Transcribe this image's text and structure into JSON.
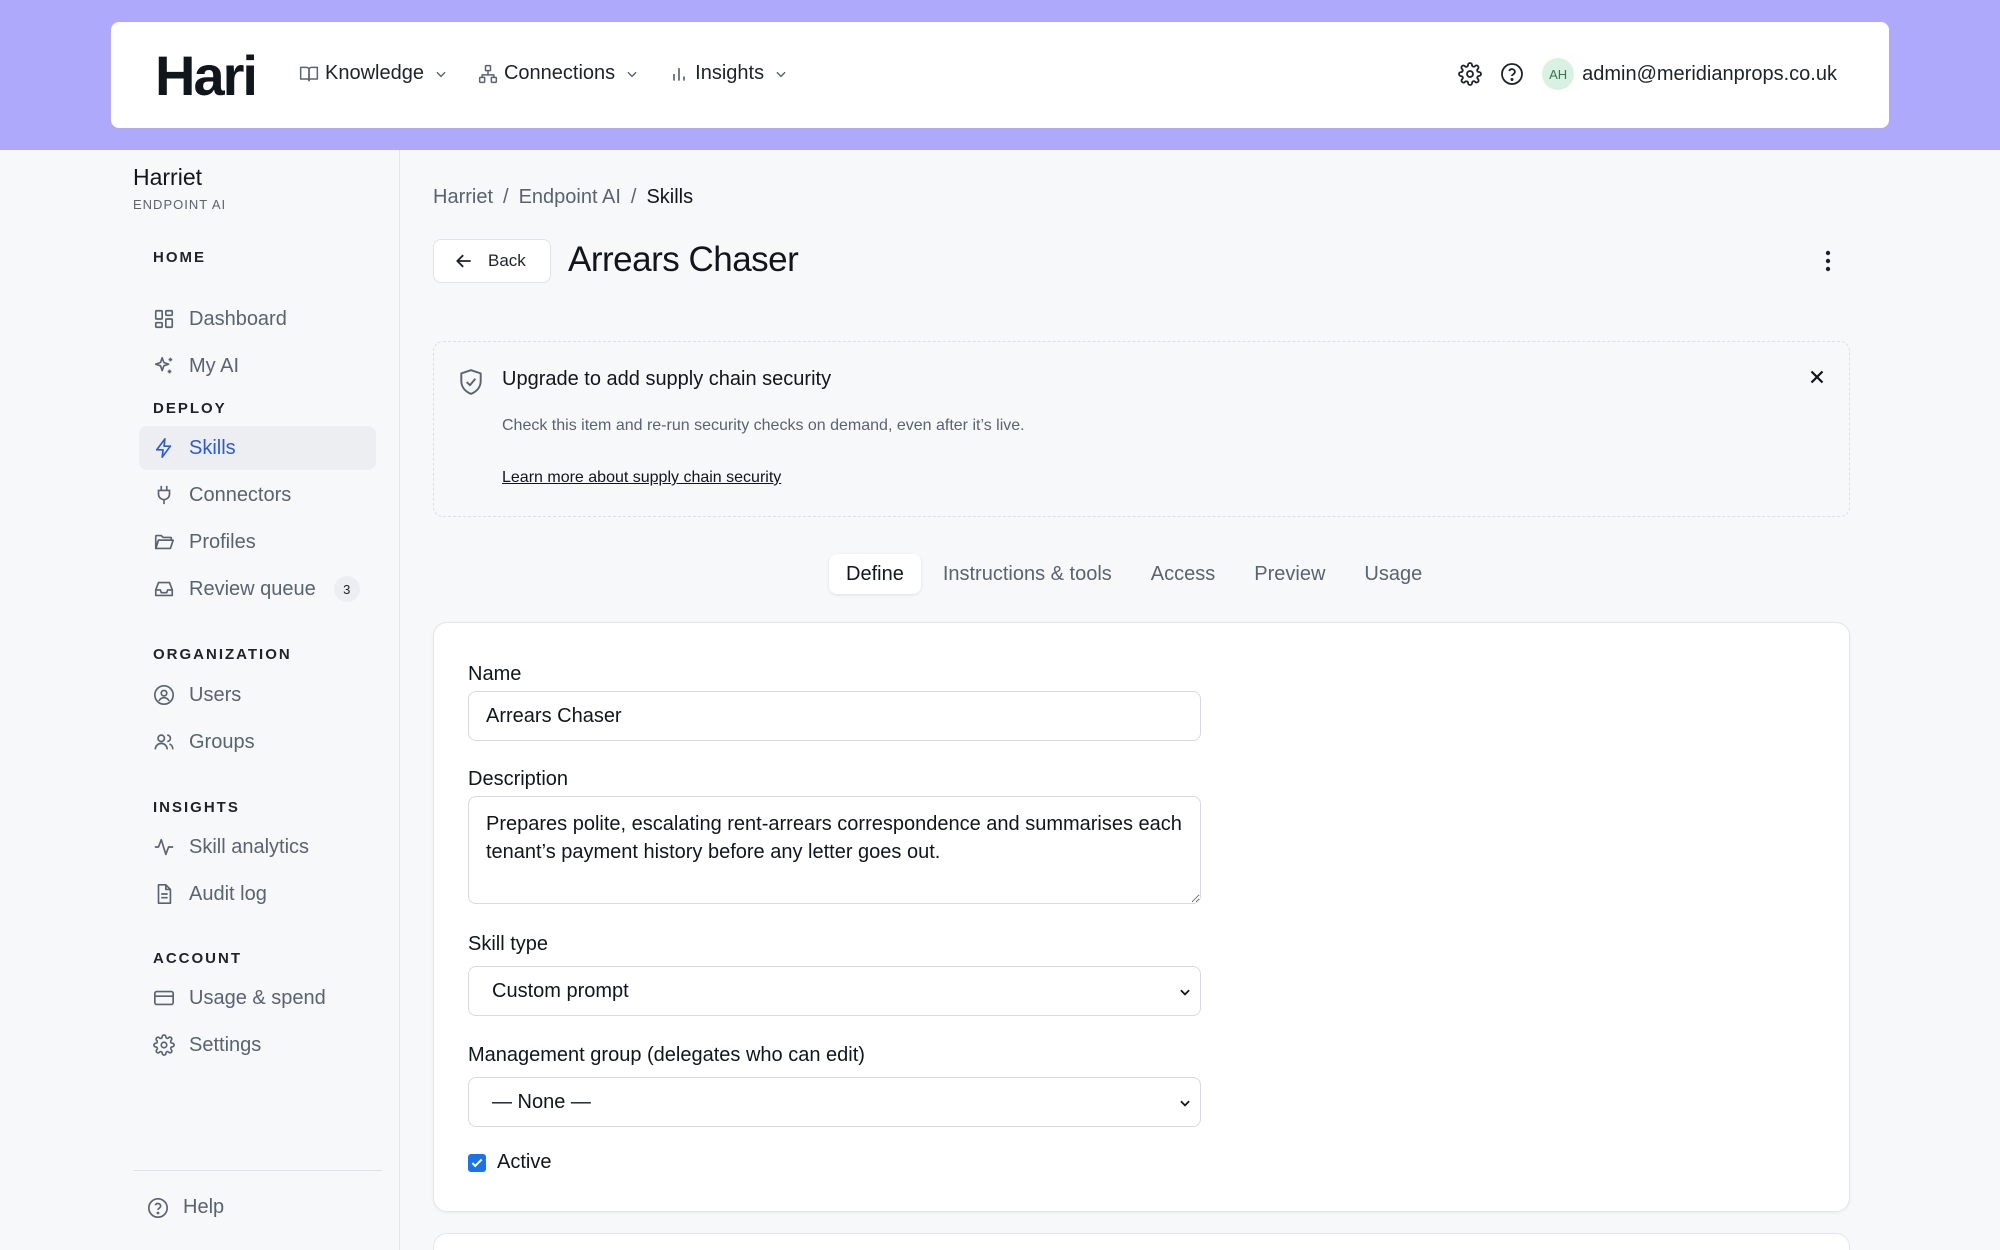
{
  "brand": {
    "logo": "Hari"
  },
  "topnav": [
    {
      "label": "Knowledge",
      "icon": "book-icon"
    },
    {
      "label": "Connections",
      "icon": "connections-icon"
    },
    {
      "label": "Insights",
      "icon": "bar-chart-icon"
    }
  ],
  "user": {
    "initials": "AH",
    "email": "admin@meridianprops.co.uk"
  },
  "sidebar": {
    "org_name": "Harriet",
    "org_sub": "ENDPOINT AI",
    "sections": {
      "home": "HOME",
      "deploy": "DEPLOY",
      "organization": "ORGANIZATION",
      "insights": "INSIGHTS",
      "account": "ACCOUNT"
    },
    "items": {
      "dashboard": "Dashboard",
      "my_ai": "My AI",
      "skills": "Skills",
      "connectors": "Connectors",
      "profiles": "Profiles",
      "review_queue": "Review queue",
      "review_queue_count": "3",
      "users": "Users",
      "groups": "Groups",
      "skill_analytics": "Skill analytics",
      "audit_log": "Audit log",
      "usage_spend": "Usage & spend",
      "settings": "Settings"
    },
    "help": "Help"
  },
  "breadcrumb": [
    "Harriet",
    "/",
    "Endpoint AI",
    "/",
    "Skills"
  ],
  "header": {
    "back_label": "Back",
    "title": "Arrears Chaser"
  },
  "banner": {
    "title": "Upgrade to add supply chain security",
    "text": "Check this item and re-run security checks on demand, even after it’s live.",
    "link": "Learn more about supply chain security"
  },
  "tabs": [
    "Define",
    "Instructions & tools",
    "Access",
    "Preview",
    "Usage"
  ],
  "active_tab": "Define",
  "form": {
    "name_label": "Name",
    "name_value": "Arrears Chaser",
    "description_label": "Description",
    "description_value": "Prepares polite, escalating rent-arrears correspondence and summarises each tenant’s payment history before any letter goes out.",
    "skill_type_label": "Skill type",
    "skill_type_value": "Custom prompt",
    "mgmt_group_label": "Management group (delegates who can edit)",
    "mgmt_group_value": "— None —",
    "active_label": "Active",
    "active_checked": true
  },
  "colors": {
    "accent": "#2c5bd8",
    "topband": "#aea9fb",
    "checkbox": "#1a73e8"
  }
}
